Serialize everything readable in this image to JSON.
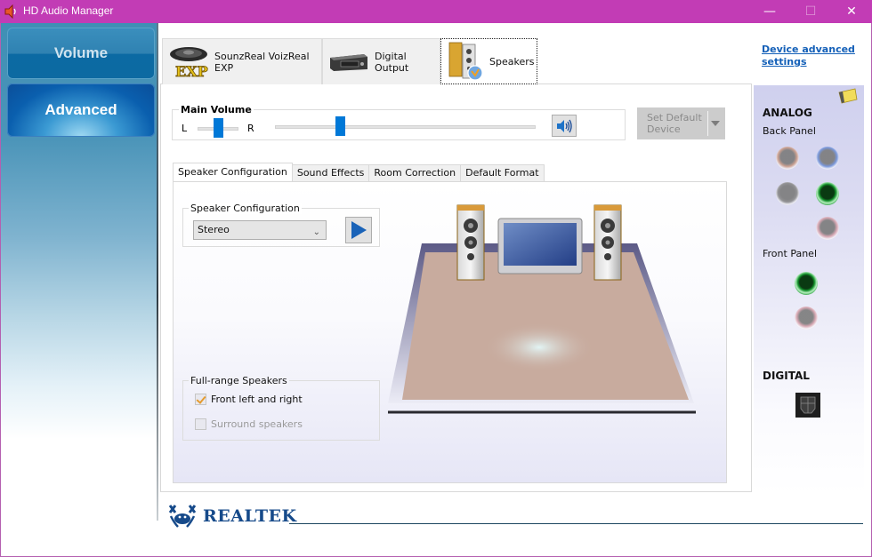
{
  "window": {
    "title": "HD Audio Manager",
    "controls": {
      "minimize": "—",
      "maximize": "☐",
      "close": "✕"
    }
  },
  "sidebar": {
    "items": [
      {
        "label": "Volume",
        "active": false
      },
      {
        "label": "Advanced",
        "active": true
      }
    ]
  },
  "device_tabs": [
    {
      "label": "SounzReal VoizReal EXP",
      "icon": "exp-speaker-icon",
      "selected": false
    },
    {
      "label": "Digital Output",
      "icon": "digital-output-device-icon",
      "selected": false
    },
    {
      "label": "Speakers",
      "icon": "speakers-icon",
      "selected": true
    }
  ],
  "device_advanced_link": {
    "line1": "Device advanced",
    "line2": "settings"
  },
  "main_volume": {
    "label": "Main Volume",
    "left_label": "L",
    "right_label": "R",
    "balance_percent": 50,
    "volume_percent": 25,
    "mute_icon": "speaker-volume-icon"
  },
  "set_default_device": {
    "line1": "Set Default",
    "line2": "Device",
    "enabled": false
  },
  "inner_tabs": [
    {
      "label": "Speaker Configuration",
      "active": true
    },
    {
      "label": "Sound Effects",
      "active": false
    },
    {
      "label": "Room Correction",
      "active": false
    },
    {
      "label": "Default Format",
      "active": false
    }
  ],
  "speaker_configuration": {
    "group_label": "Speaker Configuration",
    "selected": "Stereo",
    "play_button_icon": "play-icon"
  },
  "full_range_speakers": {
    "group_label": "Full-range Speakers",
    "options": [
      {
        "label": "Front left and right",
        "checked": true,
        "enabled": true
      },
      {
        "label": "Surround speakers",
        "checked": false,
        "enabled": false
      }
    ]
  },
  "jack_panel": {
    "analog_title": "ANALOG",
    "back_panel_label": "Back Panel",
    "back_jacks": [
      {
        "color": "#c99a86",
        "active": false,
        "name": "orange"
      },
      {
        "color": "#6f90d8",
        "active": false,
        "name": "blue"
      },
      {
        "color": "#8a8a8a",
        "active": false,
        "name": "gray"
      },
      {
        "color": "#12902a",
        "active": true,
        "name": "green"
      },
      {
        "color": "#d6a1ac",
        "active": false,
        "name": "pink"
      }
    ],
    "front_panel_label": "Front Panel",
    "front_jacks": [
      {
        "color": "#12902a",
        "active": true,
        "name": "green"
      },
      {
        "color": "#d6a1ac",
        "active": false,
        "name": "pink"
      }
    ],
    "digital_title": "DIGITAL"
  },
  "footer": {
    "brand": "REALTEK"
  },
  "colors": {
    "titlebar": "#c23cb5",
    "accent": "#0078d7",
    "link": "#1460b8",
    "brand": "#164a8a"
  }
}
